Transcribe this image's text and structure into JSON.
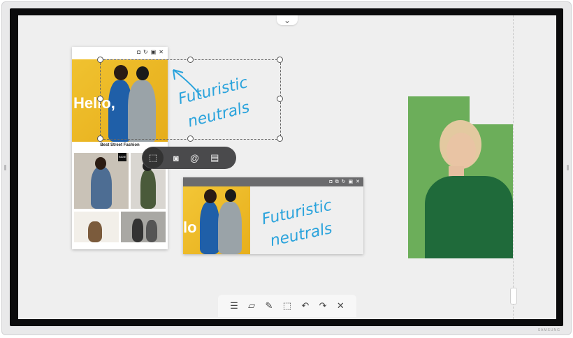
{
  "brand": "SAMSUNG",
  "colors": {
    "accent_ink": "#2aa3dc",
    "window_bar": "#6b6b6d",
    "popup_bg": "#4a4a4c",
    "green_backdrop": "#6cae5a",
    "yellow_backdrop": "#f0c230"
  },
  "top_tab": {
    "icon": "chevron-down-icon",
    "glyph": "⌄"
  },
  "left_board": {
    "window_icons": [
      {
        "name": "camera-icon",
        "glyph": "◘"
      },
      {
        "name": "rotate-icon",
        "glyph": "↻"
      },
      {
        "name": "pin-icon",
        "glyph": "▣"
      },
      {
        "name": "close-icon",
        "glyph": "✕"
      }
    ],
    "hero_text": "Hello,",
    "caption": "Best Street Fashion",
    "badge": "INDIE"
  },
  "handwriting": {
    "line1": "Futuristic",
    "line2": "neutrals"
  },
  "popup_toolbar": [
    {
      "name": "crop-tool-icon",
      "glyph": "⬚"
    },
    {
      "name": "camera-icon",
      "glyph": "◙"
    },
    {
      "name": "share-at-icon",
      "glyph": "@"
    },
    {
      "name": "document-icon",
      "glyph": "▤"
    }
  ],
  "right_window": {
    "window_icons": [
      {
        "name": "camera-icon",
        "glyph": "◘"
      },
      {
        "name": "copy-icon",
        "glyph": "⧉"
      },
      {
        "name": "rotate-icon",
        "glyph": "↻"
      },
      {
        "name": "pin-icon",
        "glyph": "▣"
      },
      {
        "name": "close-icon",
        "glyph": "✕"
      }
    ],
    "hero_text": "lo"
  },
  "bottom_toolbar": [
    {
      "name": "menu-icon",
      "glyph": "☰"
    },
    {
      "name": "new-note-icon",
      "glyph": "▱"
    },
    {
      "name": "edit-note-icon",
      "glyph": "✎"
    },
    {
      "name": "select-area-icon",
      "glyph": "⬚"
    },
    {
      "name": "undo-icon",
      "glyph": "↶"
    },
    {
      "name": "redo-icon",
      "glyph": "↷"
    },
    {
      "name": "close-icon",
      "glyph": "✕"
    }
  ]
}
